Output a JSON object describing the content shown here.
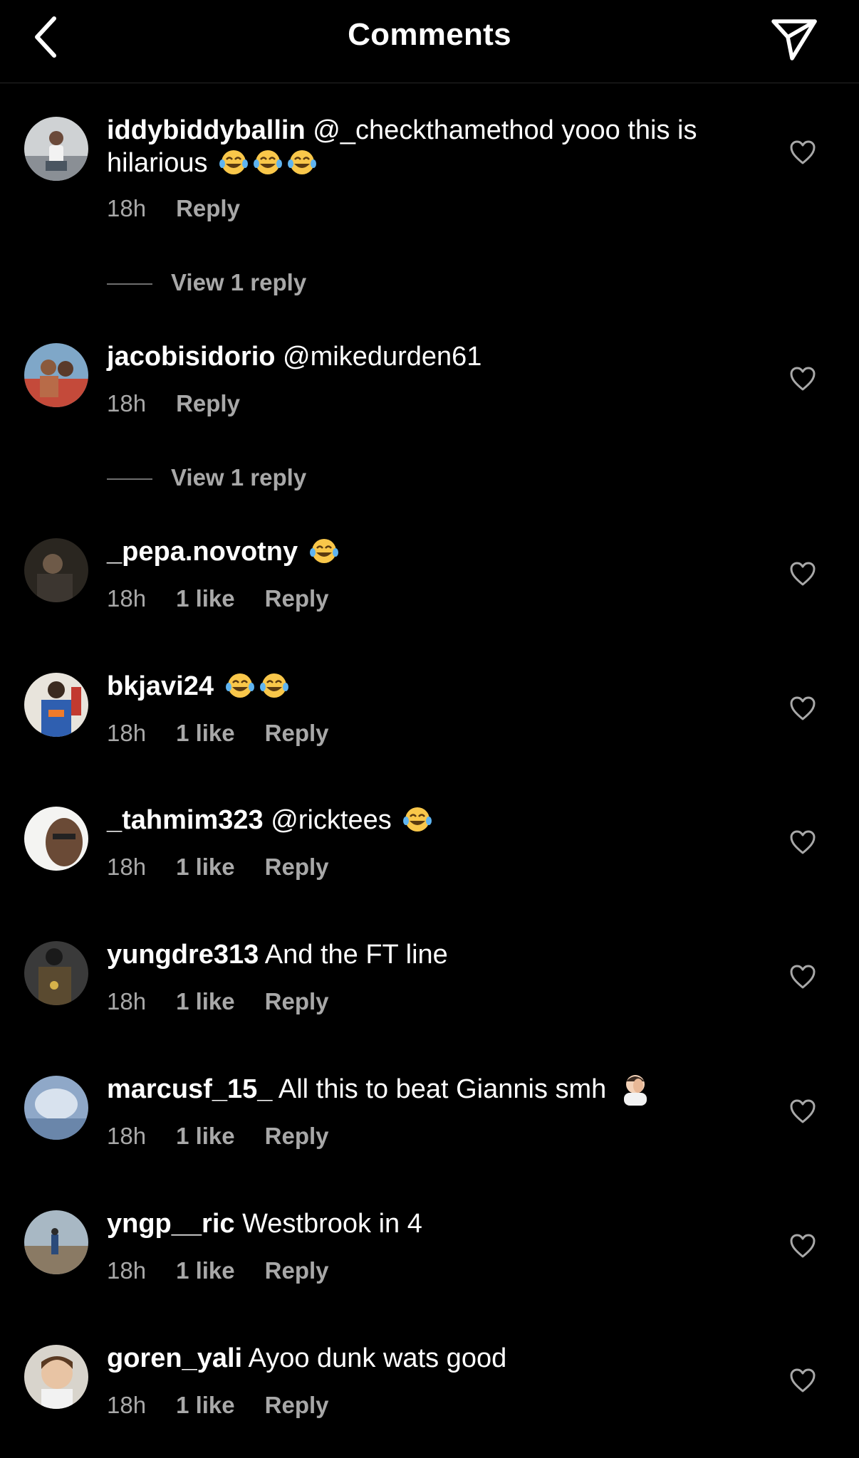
{
  "header": {
    "title": "Comments",
    "back_icon": "chevron-left-icon",
    "share_icon": "paper-plane-icon"
  },
  "colors": {
    "background": "#000000",
    "primary_text": "#ffffff",
    "secondary_text": "#a8a8a8"
  },
  "comments": [
    {
      "username": "iddybiddyballin",
      "text": "@_checkthamethod yooo this is hilarious",
      "emoji_count": 3,
      "time": "18h",
      "likes": "",
      "reply_label": "Reply",
      "view_replies": "View 1 reply"
    },
    {
      "username": "jacobisidorio",
      "text": "@mikedurden61",
      "emoji_count": 0,
      "time": "18h",
      "likes": "",
      "reply_label": "Reply",
      "view_replies": "View 1 reply"
    },
    {
      "username": "_pepa.novotny",
      "text": "",
      "emoji_count": 1,
      "time": "18h",
      "likes": "1 like",
      "reply_label": "Reply"
    },
    {
      "username": "bkjavi24",
      "text": "",
      "emoji_count": 2,
      "time": "18h",
      "likes": "1 like",
      "reply_label": "Reply"
    },
    {
      "username": "_tahmim323",
      "text": "@ricktees",
      "emoji_count": 1,
      "time": "18h",
      "likes": "1 like",
      "reply_label": "Reply"
    },
    {
      "username": "yungdre313",
      "text": "And the FT line",
      "emoji_count": 0,
      "time": "18h",
      "likes": "1 like",
      "reply_label": "Reply"
    },
    {
      "username": "marcusf_15_",
      "text": "All this to beat Giannis smh",
      "emoji_count": 0,
      "facepalm": true,
      "time": "18h",
      "likes": "1 like",
      "reply_label": "Reply"
    },
    {
      "username": "yngp__ric",
      "text": "Westbrook in 4",
      "emoji_count": 0,
      "time": "18h",
      "likes": "1 like",
      "reply_label": "Reply"
    },
    {
      "username": "goren_yali",
      "text": "Ayoo dunk wats good",
      "emoji_count": 0,
      "time": "18h",
      "likes": "1 like",
      "reply_label": "Reply"
    }
  ]
}
